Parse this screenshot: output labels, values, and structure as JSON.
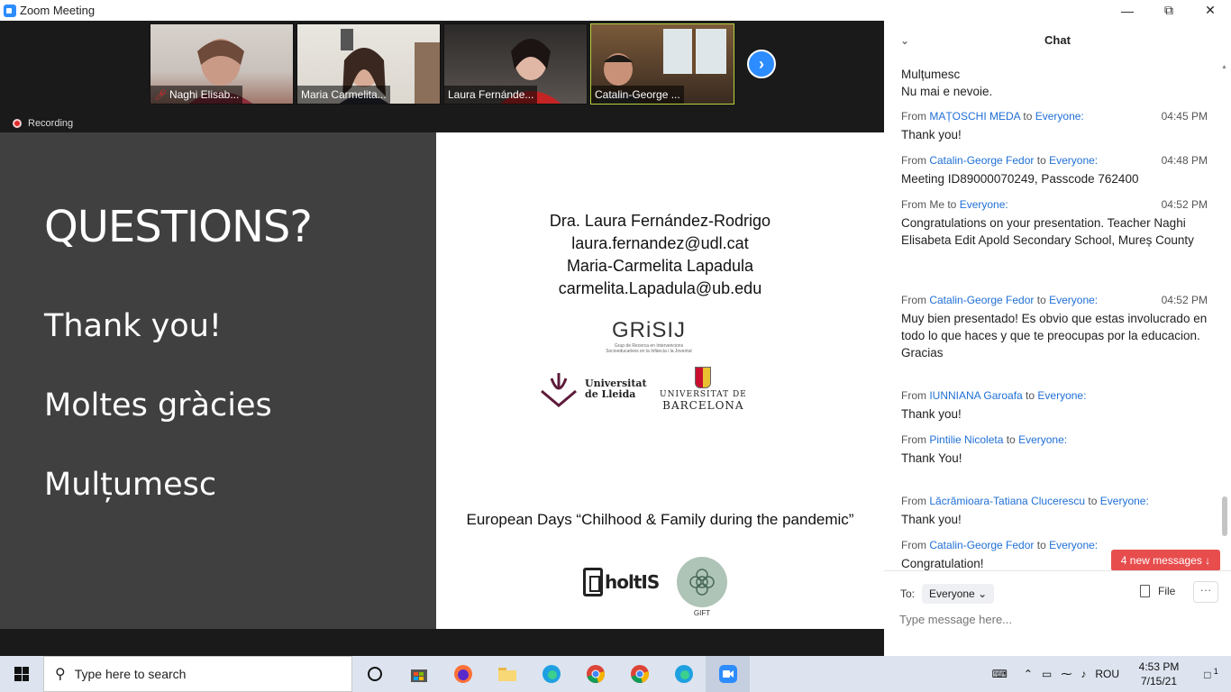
{
  "window": {
    "title": "Zoom Meeting",
    "minimize": "—",
    "maximize": "⧉",
    "close": "✕"
  },
  "participants": [
    {
      "name": "Naghi Elisab...",
      "muted": true
    },
    {
      "name": "Maria Carmelita...",
      "muted": false
    },
    {
      "name": "Laura Fernánde...",
      "muted": false
    },
    {
      "name": "Catalin-George ...",
      "muted": false
    }
  ],
  "next_arrow": "›",
  "recording_label": "Recording",
  "slide": {
    "left": {
      "questions": "QUESTIONS?",
      "line1": "Thank you!",
      "line2": "Moltes gràcies",
      "line3": "Mulțumesc"
    },
    "contacts": [
      "Dra. Laura Fernández-Rodrigo",
      "laura.fernandez@udl.cat",
      "Maria-Carmelita Lapadula",
      "carmelita.Lapadula@ub.edu"
    ],
    "grisij": {
      "main": "GRiSIJ",
      "sub": "Grup de Recerca en Intervencions Socioeducatives en la Infància i la Joventut"
    },
    "udl": {
      "line1": "Universitat",
      "line2": "de Lleida"
    },
    "ub": {
      "line1": "UNIVERSITAT DE",
      "line2": "BARCELONA"
    },
    "event": "European Days “Chilhood & Family during the pandemic”",
    "holtis": "holtIS",
    "gift": "GIFT"
  },
  "chat": {
    "title": "Chat",
    "messages": [
      {
        "from": "",
        "to": "",
        "time": "",
        "text": "Mulțumesc\nNu mai e nevoie."
      },
      {
        "from": "MAȚOSCHI MEDA",
        "to": "Everyone:",
        "time": "04:45 PM",
        "text": "Thank you!"
      },
      {
        "from": "Catalin-George Fedor",
        "to": "Everyone:",
        "time": "04:48 PM",
        "text": "Meeting ID89000070249, Passcode 762400"
      },
      {
        "from": "Me",
        "to": "Everyone:",
        "time": "04:52 PM",
        "text": "Congratulations on your presentation. Teacher Naghi Elisabeta Edit Apold Secondary School, Mureș County"
      },
      {
        "from": "Catalin-George Fedor",
        "to": "Everyone:",
        "time": "04:52 PM",
        "text": "Muy bien presentado! Es obvio que estas involucrado en todo lo que haces y que te preocupas por la educacion.\nGracias"
      },
      {
        "from": "IUNNIANA Garoafa",
        "to": "Everyone:",
        "time": "",
        "text": "Thank you!"
      },
      {
        "from": "Pintilie Nicoleta",
        "to": "Everyone:",
        "time": "",
        "text": "Thank You!"
      },
      {
        "from": "Lăcrămioara-Tatiana Clucerescu",
        "to": "Everyone:",
        "time": "",
        "text": "Thank you!"
      },
      {
        "from": "Catalin-George Fedor",
        "to": "Everyone:",
        "time": "",
        "text": "Congratulation!"
      }
    ],
    "new_messages": "4 new messages ↓",
    "to_label": "To:",
    "recipient": "Everyone",
    "file_label": "File",
    "more": "···",
    "input_placeholder": "Type message here..."
  },
  "taskbar": {
    "search_placeholder": "Type here to search",
    "language": "ROU",
    "time": "4:53 PM",
    "date": "7/15/21",
    "notifications": "1"
  }
}
